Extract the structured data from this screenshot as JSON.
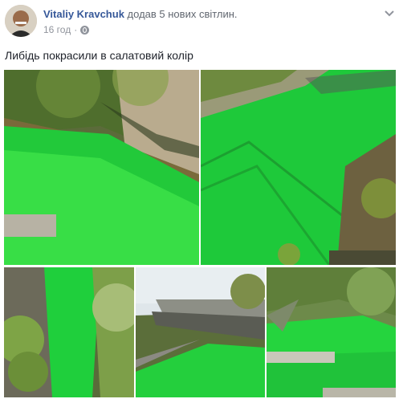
{
  "post": {
    "author": "Vitaliy Kravchuk",
    "action": "додав 5 нових світлин.",
    "time": "16 год",
    "separator": "·",
    "caption": "Либідь покрасили в салатовий колір"
  },
  "icons": {
    "avatar": "profile-photo",
    "audience": "globe-icon",
    "menu": "chevron-down-icon"
  },
  "colors": {
    "author_link": "#365899",
    "meta_text": "#90949c",
    "water_green": "#1fd43a"
  },
  "photos": [
    {
      "name": "photo-1"
    },
    {
      "name": "photo-2"
    },
    {
      "name": "photo-3"
    },
    {
      "name": "photo-4"
    },
    {
      "name": "photo-5"
    }
  ]
}
